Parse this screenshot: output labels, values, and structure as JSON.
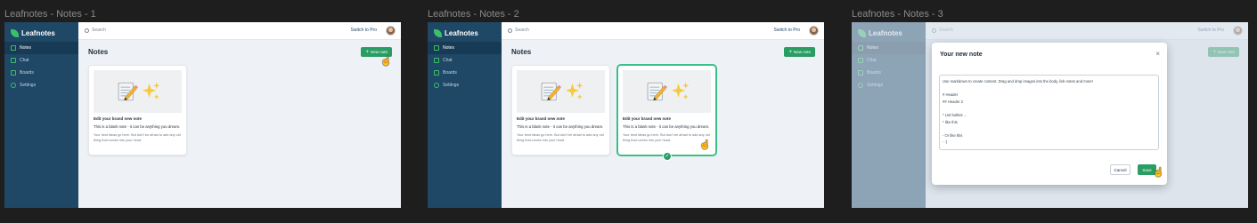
{
  "frames": [
    {
      "title": "Leafnotes - Notes - 1"
    },
    {
      "title": "Leafnotes - Notes - 2"
    },
    {
      "title": "Leafnotes - Notes - 3"
    }
  ],
  "app": {
    "logo": "Leafnotes",
    "nav": [
      {
        "label": "Notes",
        "icon": "edit-icon"
      },
      {
        "label": "Chat",
        "icon": "chat-icon"
      },
      {
        "label": "Boards",
        "icon": "boards-icon"
      },
      {
        "label": "Settings",
        "icon": "settings-icon"
      }
    ],
    "search_placeholder": "Search",
    "switch_pro": "Switch to Pro",
    "page_title": "Notes",
    "new_note_label": "New note"
  },
  "note_card": {
    "title": "Edit your brand new note",
    "subtitle": "This is a blank note - it can be anything you dream.",
    "body": "Your best ideas go here. But don't be afraid to add any old thing that comes into your head."
  },
  "modal": {
    "title": "Your new note",
    "close": "×",
    "content_lines": [
      "Use markdown to create content. Drag and drop images into the body, link notes and more!",
      "",
      "# Header",
      "## Header 2",
      "",
      "* List bullets ...",
      "* like this",
      "",
      "- Or like this",
      "- :)"
    ],
    "cancel_label": "Cancel",
    "save_label": "Save"
  },
  "partial_card_caption": "new note",
  "colors": {
    "sidebar": "#1f4766",
    "accent": "#2a9d64",
    "leaf": "#3bbf6a",
    "canvas": "#1e1e1e"
  }
}
